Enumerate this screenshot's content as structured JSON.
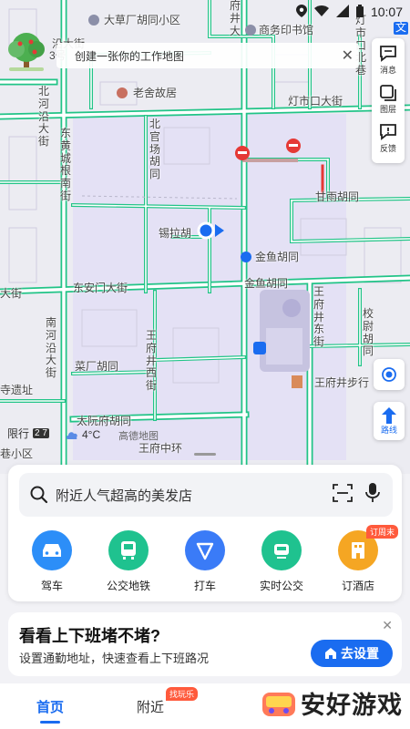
{
  "status_bar": {
    "time": "10:07"
  },
  "banner": {
    "text": "创建一张你的工作地图",
    "close": "✕"
  },
  "tools": [
    {
      "id": "message",
      "label": "消息"
    },
    {
      "id": "layers",
      "label": "图层"
    },
    {
      "id": "feedback",
      "label": "反馈"
    }
  ],
  "map": {
    "labels": {
      "dacaochang": "大草厂胡同小区",
      "fujing": "府井大",
      "commerce_press": "商务印书馆",
      "dengshikou_xiang": "灯市口北巷",
      "yanjiahu": "沿大街",
      "three": "3号",
      "lao_she": "老舍故居",
      "dengshikou_st": "灯市口大街",
      "beihe": "北河沿大街",
      "dhcg": "东黄城根南街",
      "beiguanchang": "北官场胡同",
      "ganyu": "甘雨胡同",
      "xila": "锡拉胡",
      "jinyu": "金鱼胡同",
      "daj": "大街",
      "dam": "东安门大街",
      "jinyu_st": "金鱼胡同",
      "wangfujing_dong": "王府井东街",
      "xiaowei": "校尉胡同",
      "nanhe": "南河沿大街",
      "wangfu_xi": "王府井西街",
      "caichang": "菜厂胡同",
      "wfj_walk": "王府井步行",
      "bridge": "寺遗址",
      "taijichang": "太阮府胡同",
      "wangfu_central": "王府中环",
      "limit": "限行",
      "limit_num": "2 7",
      "xiaoqu": "巷小区",
      "wen": "文"
    },
    "scale_text": "限行",
    "weather": "4°C",
    "brand": "高德地图"
  },
  "search": {
    "placeholder": "附近人气超高的美发店"
  },
  "quick_actions": [
    {
      "id": "drive",
      "label": "驾车",
      "color": "#2c8ef8"
    },
    {
      "id": "transit",
      "label": "公交地铁",
      "color": "#1fc28f"
    },
    {
      "id": "taxi",
      "label": "打车",
      "color": "#3a7bf7"
    },
    {
      "id": "realtime_bus",
      "label": "实时公交",
      "color": "#1fc28f"
    },
    {
      "id": "hotel",
      "label": "订酒店",
      "color": "#f5a623",
      "tag": "订周末"
    }
  ],
  "commute": {
    "title": "看看上下班堵不堵?",
    "subtitle": "设置通勤地址，快速查看上下班路况",
    "button": "去设置",
    "close": "✕"
  },
  "bottom_nav": [
    {
      "id": "home",
      "label": "首页",
      "active": true
    },
    {
      "id": "nearby",
      "label": "附近",
      "tag": "找玩乐"
    }
  ],
  "watermark": {
    "text": "安好游戏"
  }
}
